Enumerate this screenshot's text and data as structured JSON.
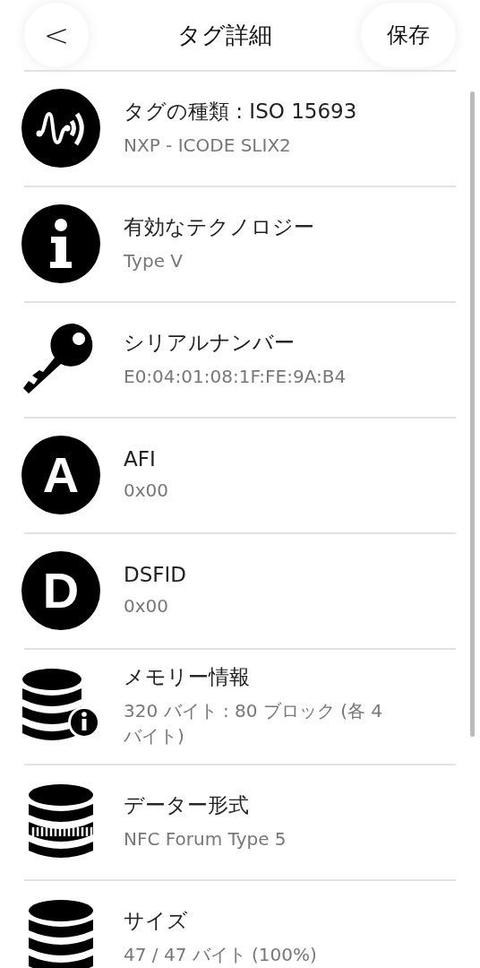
{
  "header": {
    "back": "<",
    "title": "タグ詳細",
    "save": "保存"
  },
  "rows": [
    {
      "kind": "nfc",
      "label": "タグの種類 : ISO 15693",
      "value": "NXP - ICODE SLIX2"
    },
    {
      "kind": "info",
      "label": "有効なテクノロジー",
      "value": "Type V"
    },
    {
      "kind": "key",
      "label": "シリアルナンバー",
      "value": "E0:04:01:08:1F:FE:9A:B4"
    },
    {
      "kind": "letter",
      "letter": "A",
      "label": "AFI",
      "value": "0x00"
    },
    {
      "kind": "letter",
      "letter": "D",
      "label": "DSFID",
      "value": "0x00"
    },
    {
      "kind": "database-info",
      "label": "メモリー情報",
      "value": "320 バイト : 80 ブロック (各 4 バイト)"
    },
    {
      "kind": "database-format",
      "label": "データー形式",
      "value": "NFC Forum Type 5"
    },
    {
      "kind": "database",
      "label": "サイズ",
      "value": "47 / 47 バイト (100%)"
    }
  ]
}
